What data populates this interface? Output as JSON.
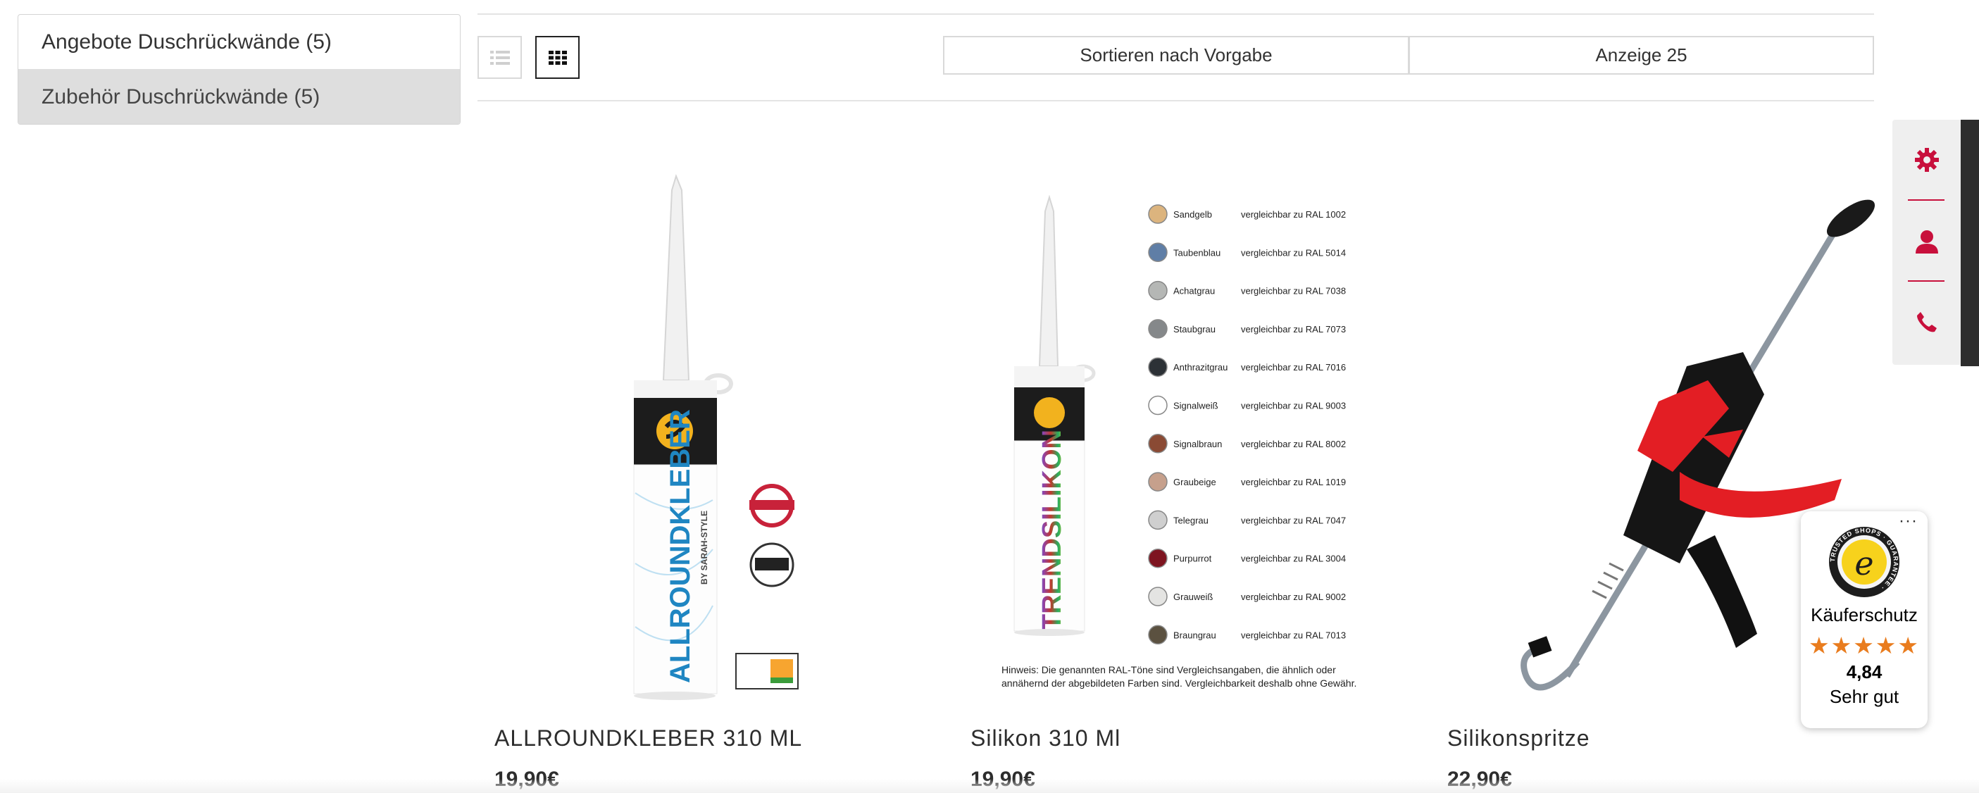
{
  "categories": [
    {
      "label": "Angebote Duschrückwände (5)",
      "active": false
    },
    {
      "label": "Zubehör Duschrückwände (5)",
      "active": true
    }
  ],
  "toolbar": {
    "sort_label": "Sortieren nach Vorgabe",
    "display_label": "Anzeige 25"
  },
  "products": [
    {
      "name": "ALLROUNDKLEBER 310 ML",
      "price": "19,90€",
      "label_text": "ALLROUNDKLEBER",
      "sub_text": "BY SARAH-STYLE"
    },
    {
      "name": "Silikon 310 Ml",
      "price": "19,90€",
      "label_text": "TRENDSILIKON",
      "colors": [
        {
          "name": "Sandgelb",
          "ral": "vergleichbar zu RAL 1002",
          "hex": "#dcb47e"
        },
        {
          "name": "Taubenblau",
          "ral": "vergleichbar zu RAL 5014",
          "hex": "#5f7ea6"
        },
        {
          "name": "Achatgrau",
          "ral": "vergleichbar zu RAL 7038",
          "hex": "#b5b7b5"
        },
        {
          "name": "Staubgrau",
          "ral": "vergleichbar zu RAL 7073",
          "hex": "#85888a"
        },
        {
          "name": "Anthrazitgrau",
          "ral": "vergleichbar zu RAL 7016",
          "hex": "#2c3136"
        },
        {
          "name": "Signalweiß",
          "ral": "vergleichbar zu RAL 9003",
          "hex": "#ffffff"
        },
        {
          "name": "Signalbraun",
          "ral": "vergleichbar zu RAL 8002",
          "hex": "#8a4a34"
        },
        {
          "name": "Graubeige",
          "ral": "vergleichbar zu RAL 1019",
          "hex": "#c6a08c"
        },
        {
          "name": "Telegrau",
          "ral": "vergleichbar zu RAL 7047",
          "hex": "#cfcfcf"
        },
        {
          "name": "Purpurrot",
          "ral": "vergleichbar zu RAL 3004",
          "hex": "#7e1420"
        },
        {
          "name": "Grauweiß",
          "ral": "vergleichbar zu RAL 9002",
          "hex": "#e4e4e2"
        },
        {
          "name": "Braungrau",
          "ral": "vergleichbar zu RAL 7013",
          "hex": "#5b5140"
        }
      ],
      "note_line1": "Hinweis: Die genannten RAL-Töne sind Vergleichsangaben, die ähnlich oder",
      "note_line2": "annähernd der abgebildeten Farben sind. Vergleichbarkeit deshalb ohne Gewähr."
    },
    {
      "name": "Silikonspritze",
      "price": "22,90€"
    }
  ],
  "side_widget": {
    "icons": [
      "gear-icon",
      "user-icon",
      "phone-icon"
    ],
    "accent": "#c8103c"
  },
  "trusted_shops": {
    "seal_text": "TRUSTED SHOPS · GUARANTEE ·",
    "label": "Käuferschutz",
    "stars": "★★★★★",
    "score": "4,84",
    "rating": "Sehr gut",
    "more": "···"
  }
}
